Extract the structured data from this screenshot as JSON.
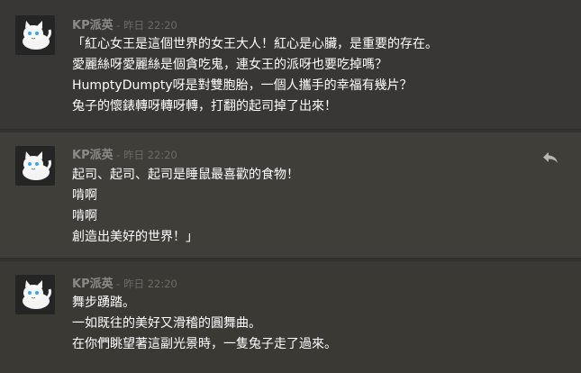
{
  "messages": [
    {
      "author": "KP派英",
      "time": " - 昨日 22:20",
      "lines": [
        "「紅心女王是這個世界的女王大人！紅心是心臟，是重要的存在。",
        "愛麗絲呀愛麗絲是個貪吃鬼，連女王的派呀也要吃掉嗎？",
        "HumptyDumpty呀是對雙胞胎，一個人攜手的幸福有幾片？",
        "兔子的懷錶轉呀轉呀轉，打翻的起司掉了出來！"
      ]
    },
    {
      "author": "KP派英",
      "time": " - 昨日 22:20",
      "lines": [
        "起司、起司、起司是睡鼠最喜歡的食物！",
        "啃啊",
        "啃啊",
        "創造出美好的世界！」"
      ]
    },
    {
      "author": "KP派英",
      "time": " - 昨日 22:20",
      "lines": [
        "舞步踴踏。",
        "一如既往的美好又滑稽的圓舞曲。",
        "在你們眺望著這副光景時，一隻兔子走了過來。"
      ]
    }
  ],
  "icons": {
    "reply": "reply-arrow-icon",
    "avatar": "white-cat-avatar"
  },
  "colors": {
    "background": "#333231",
    "author": "#8b8a86",
    "timestamp": "#6c6b67",
    "text": "#ffffff"
  }
}
